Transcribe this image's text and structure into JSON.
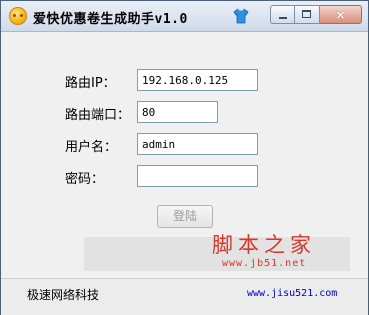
{
  "window": {
    "title": "爱快优惠卷生成助手v1.0",
    "icon": "ikuai-smiley-icon",
    "tray_icon": "tshirt-icon",
    "controls": {
      "minimize_icon": "minimize-icon",
      "maximize_icon": "maximize-icon",
      "close_glyph": "×"
    }
  },
  "form": {
    "router_ip_label": "路由IP：",
    "router_ip_value": "192.168.0.125",
    "router_port_label": "路由端口：",
    "router_port_value": "80",
    "username_label": "用户名：",
    "username_value": "admin",
    "password_label": "密码：",
    "password_value": "",
    "login_button": "登陆"
  },
  "watermark": {
    "title": "脚本之家",
    "url": "www.jb51.net"
  },
  "statusbar": {
    "company": "极速网络科技",
    "website": "www.jisu521.com"
  },
  "colors": {
    "watermark": "#d8362a",
    "link": "#0000c8",
    "disabled_text": "#9a9a9a"
  }
}
